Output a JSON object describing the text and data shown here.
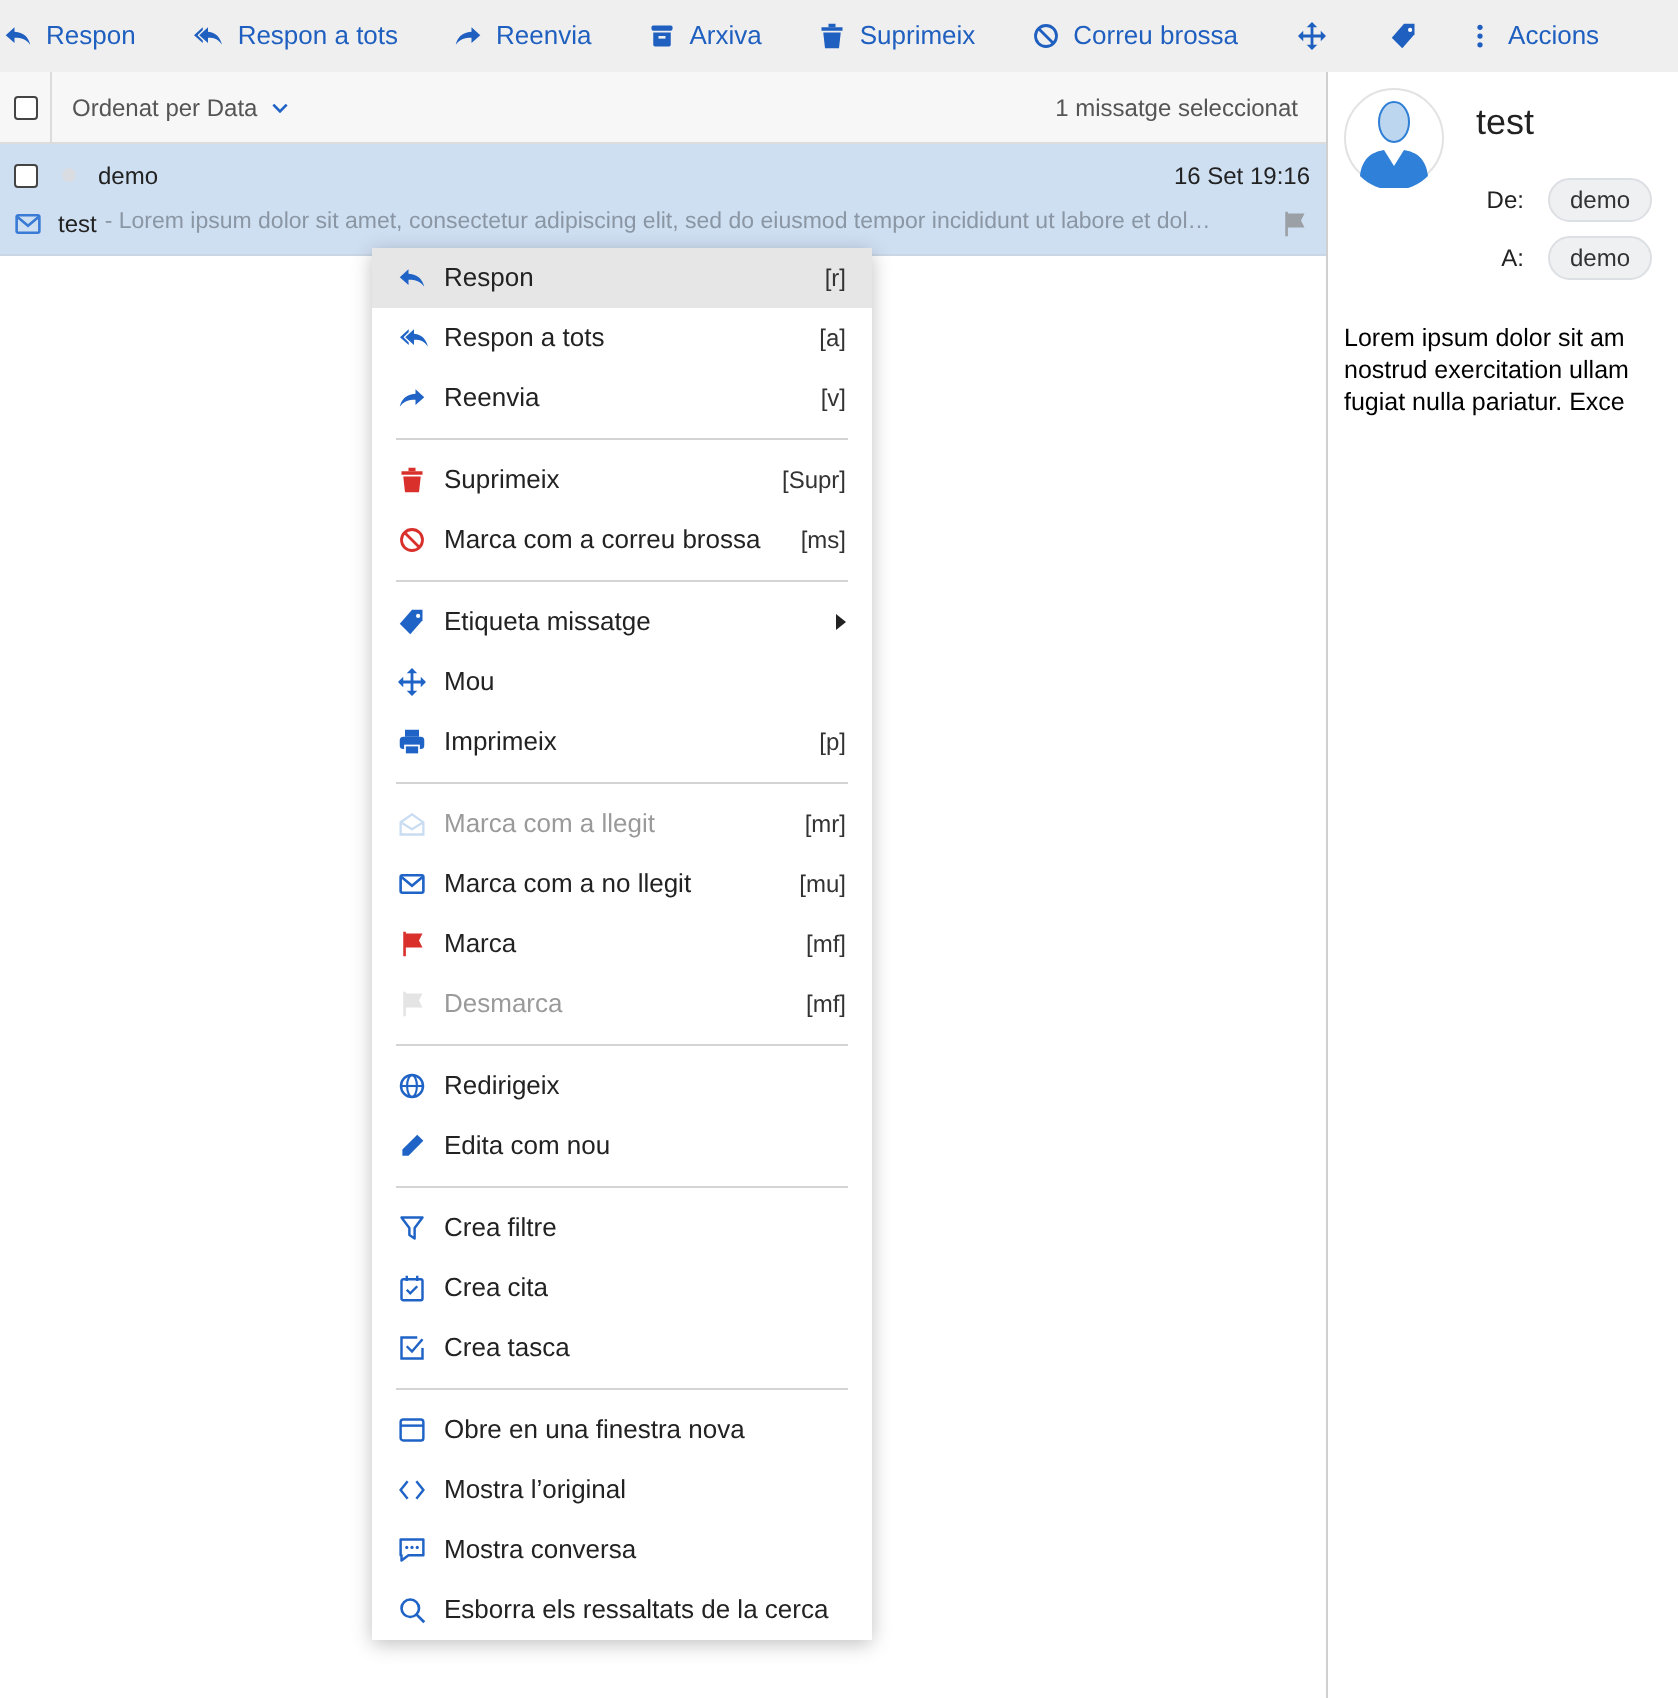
{
  "toolbar": [
    {
      "kind": "labeled",
      "label": "Respon"
    },
    {
      "kind": "labeled",
      "label": "Respon a tots"
    },
    {
      "kind": "labeled",
      "label": "Reenvia"
    },
    {
      "kind": "labeled",
      "label": "Arxiva"
    },
    {
      "kind": "labeled",
      "label": "Suprimeix"
    },
    {
      "kind": "labeled",
      "label": "Correu brossa"
    },
    {
      "kind": "icon"
    },
    {
      "kind": "icon"
    },
    {
      "kind": "labeled",
      "label": "Accions"
    }
  ],
  "list_header": {
    "sort": "Ordenat per Data",
    "selection": "1 missatge seleccionat",
    "all_checked": false
  },
  "messages": [
    {
      "from": "demo",
      "date": "16 Set 19:16",
      "subject": "test",
      "snippet": "- Lorem ipsum dolor sit amet, consectetur adipiscing elit, sed do eiusmod tempor incididunt ut labore et dol…",
      "selected": true,
      "checked": false,
      "flagged": false
    }
  ],
  "context_menu": {
    "groups": [
      [
        {
          "label": "Respon",
          "shortcut": "[r]",
          "selected": true,
          "disabled": false,
          "submenu": false
        },
        {
          "label": "Respon a tots",
          "shortcut": "[a]",
          "selected": false,
          "disabled": false,
          "submenu": false
        },
        {
          "label": "Reenvia",
          "shortcut": "[v]",
          "selected": false,
          "disabled": false,
          "submenu": false
        }
      ],
      [
        {
          "label": "Suprimeix",
          "shortcut": "[Supr]",
          "selected": false,
          "disabled": false,
          "submenu": false
        },
        {
          "label": "Marca com a correu brossa",
          "shortcut": "[ms]",
          "selected": false,
          "disabled": false,
          "submenu": false
        }
      ],
      [
        {
          "label": "Etiqueta missatge",
          "selected": false,
          "disabled": false,
          "submenu": true
        },
        {
          "label": "Mou",
          "selected": false,
          "disabled": false,
          "submenu": false
        },
        {
          "label": "Imprimeix",
          "shortcut": "[p]",
          "selected": false,
          "disabled": false,
          "submenu": false
        }
      ],
      [
        {
          "label": "Marca com a llegit",
          "shortcut": "[mr]",
          "selected": false,
          "disabled": true,
          "submenu": false
        },
        {
          "label": "Marca com a no llegit",
          "shortcut": "[mu]",
          "selected": false,
          "disabled": false,
          "submenu": false
        },
        {
          "label": "Marca",
          "shortcut": "[mf]",
          "selected": false,
          "disabled": false,
          "submenu": false
        },
        {
          "label": "Desmarca",
          "shortcut": "[mf]",
          "selected": false,
          "disabled": true,
          "submenu": false
        }
      ],
      [
        {
          "label": "Redirigeix",
          "selected": false,
          "disabled": false,
          "submenu": false
        },
        {
          "label": "Edita com nou",
          "selected": false,
          "disabled": false,
          "submenu": false
        }
      ],
      [
        {
          "label": "Crea filtre",
          "selected": false,
          "disabled": false,
          "submenu": false
        },
        {
          "label": "Crea cita",
          "selected": false,
          "disabled": false,
          "submenu": false
        },
        {
          "label": "Crea tasca",
          "selected": false,
          "disabled": false,
          "submenu": false
        }
      ],
      [
        {
          "label": "Obre en una finestra nova",
          "selected": false,
          "disabled": false,
          "submenu": false
        },
        {
          "label": "Mostra l’original",
          "selected": false,
          "disabled": false,
          "submenu": false
        },
        {
          "label": "Mostra conversa",
          "selected": false,
          "disabled": false,
          "submenu": false
        },
        {
          "label": "Esborra els ressaltats de la cerca",
          "selected": false,
          "disabled": false,
          "submenu": false
        }
      ]
    ]
  },
  "preview": {
    "subject": "test",
    "headers": [
      {
        "label": "De:",
        "value": "demo"
      },
      {
        "label": "A:",
        "value": "demo"
      }
    ],
    "body_lines": [
      "Lorem ipsum dolor sit am",
      "nostrud exercitation ullam",
      "fugiat nulla pariatur. Exce"
    ]
  }
}
